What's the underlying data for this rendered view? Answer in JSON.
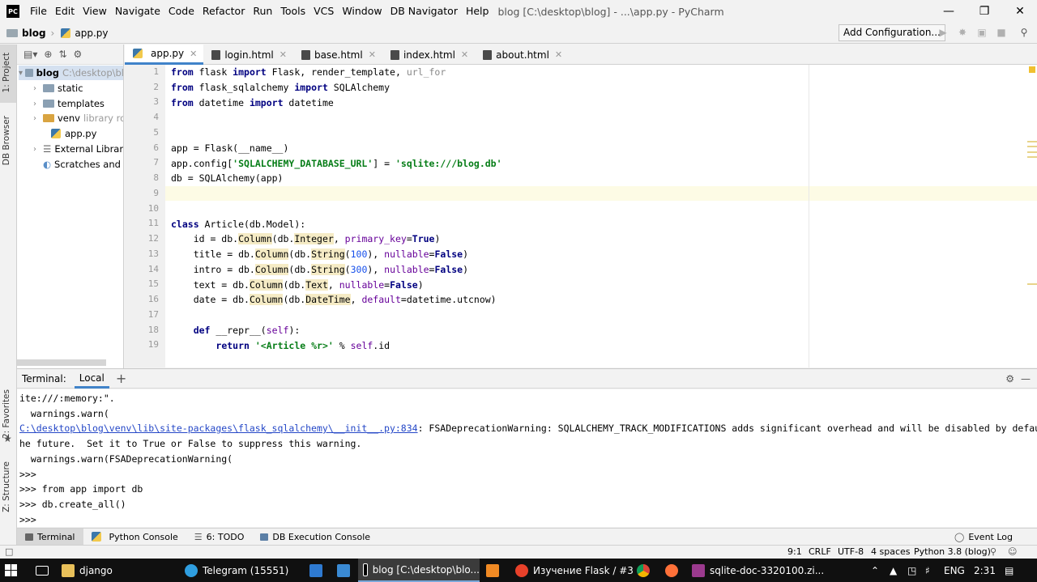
{
  "menu": {
    "logo": "PC",
    "items": [
      "File",
      "Edit",
      "View",
      "Navigate",
      "Code",
      "Refactor",
      "Run",
      "Tools",
      "VCS",
      "Window",
      "DB Navigator",
      "Help"
    ],
    "title": "blog [C:\\desktop\\blog] - ...\\app.py - PyCharm"
  },
  "nav": {
    "crumb_project": "blog",
    "crumb_file": "app.py",
    "add_configuration": "Add Configuration..."
  },
  "left_strip": {
    "project": "1: Project",
    "db_browser": "DB Browser",
    "favorites": "2: Favorites",
    "structure": "Z: Structure"
  },
  "project_tree": {
    "root_name": "blog",
    "root_path": "C:\\desktop\\bl",
    "static": "static",
    "templates": "templates",
    "venv": "venv",
    "venv_note": "library roo",
    "app_py": "app.py",
    "external_libraries": "External Libraries",
    "scratches": "Scratches and Cons"
  },
  "tabs": [
    "app.py",
    "login.html",
    "base.html",
    "index.html",
    "about.html"
  ],
  "code": {
    "line_numbers": [
      "1",
      "2",
      "3",
      "4",
      "5",
      "6",
      "7",
      "8",
      "9",
      "10",
      "11",
      "12",
      "13",
      "14",
      "15",
      "16",
      "17",
      "18",
      "19"
    ]
  },
  "terminal": {
    "label": "Terminal:",
    "tab": "Local",
    "add": "+",
    "lines": [
      "ite:///:memory:\".",
      "  warnings.warn(",
      "",
      "he future.  Set it to True or False to suppress this warning.",
      "  warnings.warn(FSADeprecationWarning(",
      ">>>",
      ">>> from app import db",
      ">>> db.create_all()",
      ">>>"
    ],
    "warning_link": "C:\\desktop\\blog\\venv\\lib\\site-packages\\flask_sqlalchemy\\__init__.py:834",
    "warning_text": ": FSADeprecationWarning: SQLALCHEMY_TRACK_MODIFICATIONS adds significant overhead and will be disabled by default in t"
  },
  "bottom_tabs": [
    "Terminal",
    "Python Console",
    "6: TODO",
    "DB Execution Console"
  ],
  "event_log": "Event Log",
  "status": {
    "position": "9:1",
    "line_sep": "CRLF",
    "encoding": "UTF-8",
    "indent": "4 spaces",
    "interpreter": "Python 3.8 (blog)"
  },
  "taskbar": {
    "items": [
      "django",
      "Telegram (15551)",
      "blog [C:\\desktop\\blo...",
      "Изучение Flask / #3 -...",
      "sqlite-doc-3320100.zi..."
    ],
    "lang": "ENG",
    "time": "2:31"
  },
  "colors": {
    "keyword": "#000080",
    "string": "#067d17",
    "number": "#1750eb",
    "param": "#660099",
    "accent": "#4083c9"
  }
}
